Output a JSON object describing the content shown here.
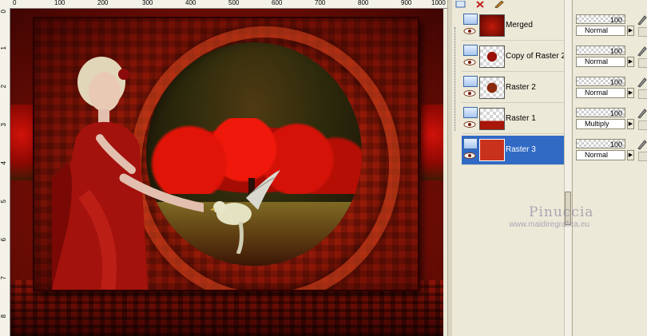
{
  "rulers": {
    "top": [
      "0",
      "100",
      "200",
      "300",
      "400",
      "500",
      "600",
      "700",
      "800",
      "900",
      "1000"
    ],
    "left": [
      "0",
      "1",
      "2",
      "3",
      "4",
      "5",
      "6",
      "7",
      "8"
    ]
  },
  "layers": [
    {
      "name": "Merged",
      "thumb": "merged",
      "opacity": "100",
      "blend": "Normal",
      "selected": false
    },
    {
      "name": "Copy of Raster 2",
      "thumb": "copy",
      "opacity": "100",
      "blend": "Normal",
      "selected": false
    },
    {
      "name": "Raster 2",
      "thumb": "r2",
      "opacity": "100",
      "blend": "Normal",
      "selected": false
    },
    {
      "name": "Raster 1",
      "thumb": "r1",
      "opacity": "100",
      "blend": "Multiply",
      "selected": false
    },
    {
      "name": "Raster 3",
      "thumb": "r3",
      "opacity": "100",
      "blend": "Normal",
      "selected": true
    }
  ],
  "icons": {
    "layer_type": "raster-layer-icon",
    "visibility": "eye-icon",
    "edit": "pencil-icon",
    "lock": "lock-icon",
    "dropdown": "play-arrow-icon"
  },
  "watermark": {
    "title": "Pinuccia",
    "url": "www.maidiregrafica.eu"
  },
  "colors": {
    "selected_row": "#316ac5",
    "raster3_fill": "#c8321c"
  }
}
